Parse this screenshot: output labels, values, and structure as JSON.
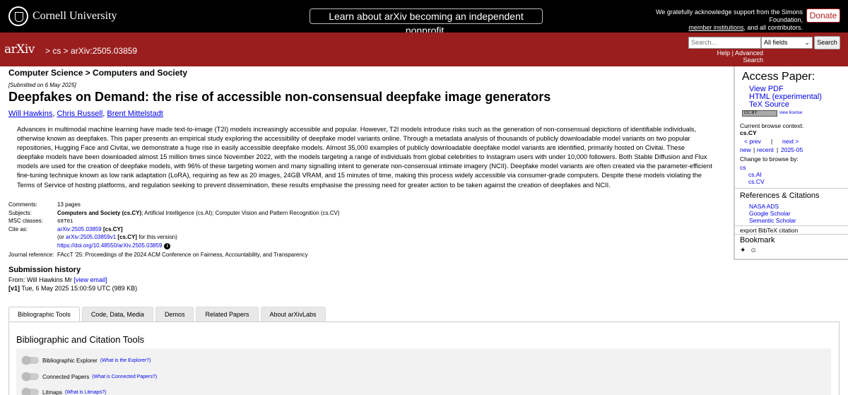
{
  "topbar": {
    "university": "Cornell University",
    "announcement": "Learn about arXiv becoming an independent nonprofit.",
    "support_line1": "We gratefully acknowledge support from the Simons Foundation,",
    "support_link": "member institutions",
    "support_line2_tail": ", and all contributors.",
    "donate": "Donate"
  },
  "header": {
    "logo": "arXiv",
    "breadcrumb": "> cs > arXiv:2505.03859",
    "search_placeholder": "Search...",
    "search_field": "All fields",
    "search_button": "Search",
    "help": "Help",
    "separator": "|",
    "advanced": "Advanced Search"
  },
  "paper": {
    "subject_heading": "Computer Science > Computers and Society",
    "submitted": "[Submitted on 6 May 2025]",
    "title": "Deepfakes on Demand: the rise of accessible non-consensual deepfake image generators",
    "authors": [
      "Will Hawkins",
      "Chris Russell",
      "Brent Mittelstadt"
    ],
    "author_sep": ", ",
    "abstract": "Advances in multimodal machine learning have made text-to-image (T2I) models increasingly accessible and popular. However, T2I models introduce risks such as the generation of non-consensual depictions of identifiable individuals, otherwise known as deepfakes. This paper presents an empirical study exploring the accessibility of deepfake model variants online. Through a metadata analysis of thousands of publicly downloadable model variants on two popular repositories, Hugging Face and Civitai, we demonstrate a huge rise in easily accessible deepfake models. Almost 35,000 examples of publicly downloadable deepfake model variants are identified, primarily hosted on Civitai. These deepfake models have been downloaded almost 15 million times since November 2022, with the models targeting a range of individuals from global celebrities to Instagram users with under 10,000 followers. Both Stable Diffusion and Flux models are used for the creation of deepfake models, with 96% of these targeting women and many signalling intent to generate non-consensual intimate imagery (NCII). Deepfake model variants are often created via the parameter-efficient fine-tuning technique known as low rank adaptation (LoRA), requiring as few as 20 images, 24GB VRAM, and 15 minutes of time, making this process widely accessible via consumer-grade computers. Despite these models violating the Terms of Service of hosting platforms, and regulation seeking to prevent dissemination, these results emphasise the pressing need for greater action to be taken against the creation of deepfakes and NCII."
  },
  "meta": {
    "comments_key": "Comments:",
    "comments_val": "13 pages",
    "subjects_key": "Subjects:",
    "subjects_primary": "Computers and Society (cs.CY)",
    "subjects_rest": "; Artificial Intelligence (cs.AI); Computer Vision and Pattern Recognition (cs.CV)",
    "msc_key": "MSC classes:",
    "msc_val": "68T01",
    "cite_key": "Cite as:",
    "cite_id": "arXiv:2505.03859",
    "cite_tag": "[cs.CY]",
    "cite_or": "(or ",
    "cite_v1": "arXiv:2505.03859v1",
    "cite_v1_tag": "[cs.CY]",
    "cite_v1_tail": " for this version)",
    "doi": "https://doi.org/10.48550/arXiv.2505.03859",
    "journal_key": "Journal reference:",
    "journal_val": "FAccT '25: Proceedings of the 2024 ACM Conference on Fairness, Accountability, and Transparency"
  },
  "history": {
    "title": "Submission history",
    "from": "From: Will Hawkins Mr ",
    "view_email": "[view email]",
    "v1_tag": "[v1]",
    "v1_text": " Tue, 6 May 2025 15:00:59 UTC (989 KB)"
  },
  "tabs": [
    "Bibliographic Tools",
    "Code, Data, Media",
    "Demos",
    "Related Papers",
    "About arXivLabs"
  ],
  "tools": {
    "title": "Bibliographic and Citation Tools",
    "items": [
      {
        "label": "Bibliographic Explorer",
        "link": "(What is the Explorer?)"
      },
      {
        "label": "Connected Papers",
        "link": "(What is Connected Papers?)"
      },
      {
        "label": "Litmaps",
        "link": "(What is Litmaps?)"
      }
    ]
  },
  "sidebar": {
    "access_title": "Access Paper:",
    "view_pdf": "View PDF",
    "html": "HTML (experimental)",
    "tex": "TeX Source",
    "cc": "CC BY",
    "view_license": "view license",
    "context_label": "Current browse context:",
    "context_val": "cs.CY",
    "prev": "< prev",
    "pipe": "|",
    "next": "next >",
    "new": "new",
    "recent": "recent",
    "date": "2025-05",
    "change_label": "Change to browse by:",
    "browse": [
      "cs",
      "cs.AI",
      "cs.CV"
    ],
    "refs_title": "References & Citations",
    "refs": [
      "NASA ADS",
      "Google Scholar",
      "Semantic Scholar"
    ],
    "bibtex": "export BibTeX citation",
    "bookmark_title": "Bookmark",
    "bookmark_icons": [
      "bibsonomy-icon",
      "reddit-icon"
    ]
  }
}
